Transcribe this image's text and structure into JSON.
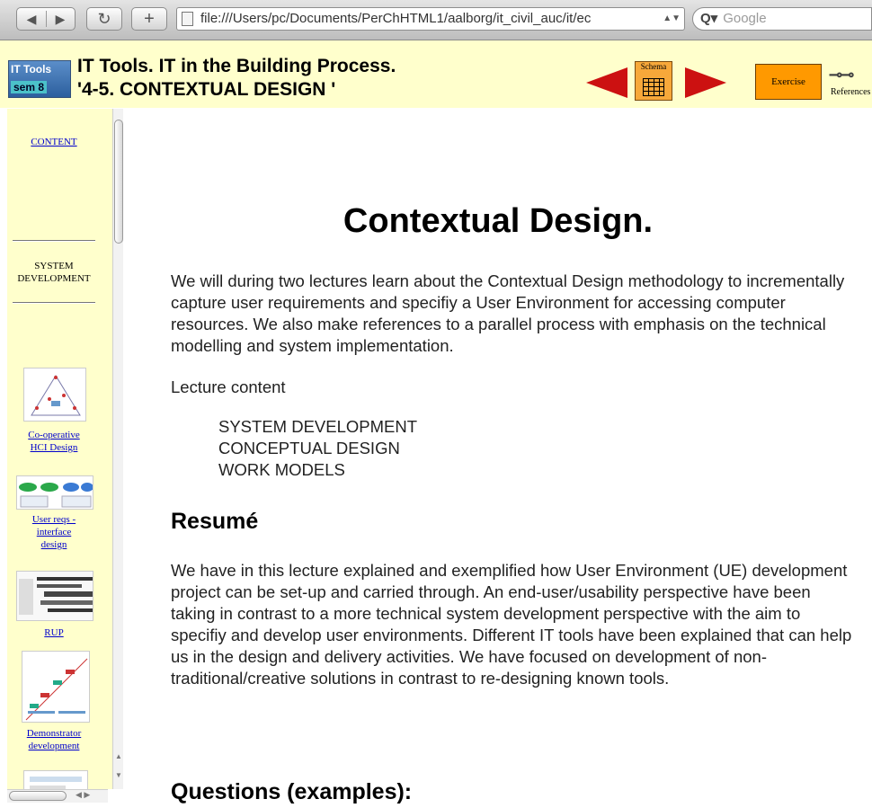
{
  "browser": {
    "url": "file:///Users/pc/Documents/PerChHTML1/aalborg/it_civil_auc/it/ec",
    "search_placeholder": "Google",
    "back_icon": "◀",
    "forward_icon": "▶",
    "reload_icon": "↻",
    "add_icon": "+"
  },
  "header": {
    "logo_line1": "IT Tools",
    "logo_line2": "sem 8",
    "title_line1": "IT Tools. IT in the Building Process.",
    "title_line2": "'4-5. CONTEXTUAL DESIGN '",
    "schema_label": "Schema",
    "exercise_label": "Exercise",
    "references_label": "References",
    "arrow_color": "#cc1111",
    "background": "#ffffcc"
  },
  "sidebar": {
    "content_link": "CONTENT",
    "section_line1": "SYSTEM",
    "section_line2": "DEVELOPMENT",
    "items": [
      {
        "line1": "Co-operative",
        "line2": "HCI Design"
      },
      {
        "line1": "User reqs -",
        "line2": "interface",
        "line3": "design"
      },
      {
        "line1": "RUP"
      },
      {
        "line1": "Demonstrator",
        "line2": "development"
      }
    ]
  },
  "main": {
    "title": "Contextual Design.",
    "intro": "We will during two lectures learn about the Contextual Design methodology to incrementally capture user requirements and specifiy a User Environment for accessing computer resources. We also make references to a parallel process with emphasis on the technical modelling and system implementation.",
    "lecture_heading": "Lecture content",
    "lecture_items": [
      "SYSTEM DEVELOPMENT",
      "CONCEPTUAL DESIGN",
      "WORK MODELS"
    ],
    "resume_heading": "Resumé",
    "resume_text": "We have in this lecture explained and exemplified how User Environment (UE) development project can be set-up and carried through. An end-user/usability perspective have been taking in contrast to a more technical system development perspective with the aim to specifiy and develop user environments. Different IT tools have been explained that can help us in the design and delivery activities. We have focused on development of non-traditional/creative solutions in contrast to re-designing known tools.",
    "questions_heading": "Questions (examples):"
  }
}
